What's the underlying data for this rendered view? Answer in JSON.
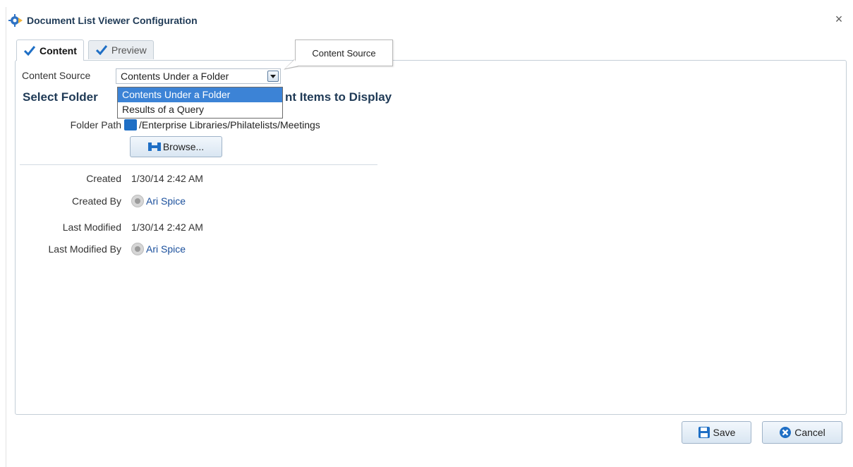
{
  "dialog": {
    "title": "Document List Viewer Configuration",
    "close_label": "×"
  },
  "tabs": [
    {
      "label": "Content",
      "active": true
    },
    {
      "label": "Preview",
      "active": false
    }
  ],
  "tooltip": {
    "text": "Content Source"
  },
  "content_source": {
    "label": "Content Source",
    "selected": "Contents Under a Folder",
    "options": [
      "Contents Under a Folder",
      "Results of a Query"
    ]
  },
  "section": {
    "heading_start": "Select Folder",
    "heading_end": "nt Items to Display"
  },
  "folder": {
    "label": "Folder Path",
    "path": "/Enterprise Libraries/Philatelists/Meetings",
    "browse_label": "Browse..."
  },
  "properties": {
    "created_label": "Created",
    "created_value": "1/30/14 2:42 AM",
    "created_by_label": "Created By",
    "created_by_value": "Ari Spice",
    "last_modified_label": "Last Modified",
    "last_modified_value": "1/30/14 2:42 AM",
    "last_modified_by_label": "Last Modified By",
    "last_modified_by_value": "Ari Spice"
  },
  "footer": {
    "save_label": "Save",
    "cancel_label": "Cancel"
  },
  "colors": {
    "heading": "#1f3a56",
    "selection": "#3c83d6",
    "link": "#1a4f9c",
    "accent": "#1f6fc5"
  },
  "icons": {
    "title": "gear-icon",
    "tab_check": "checkmark-icon",
    "folder": "folder-icon",
    "browse": "browse-icon",
    "avatar": "user-avatar-icon",
    "save": "floppy-disk-icon",
    "cancel": "cancel-icon"
  }
}
